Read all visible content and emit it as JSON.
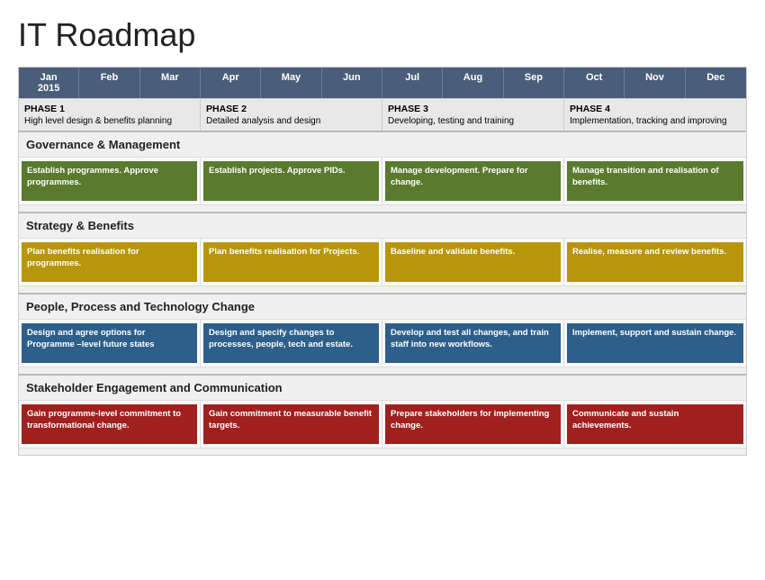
{
  "title": "IT Roadmap",
  "header": {
    "months": [
      "Jan\n2015",
      "Feb",
      "Mar",
      "Apr",
      "May",
      "Jun",
      "Jul",
      "Aug",
      "Sep",
      "Oct",
      "Nov",
      "Dec"
    ]
  },
  "phases": [
    {
      "title": "PHASE 1",
      "subtitle": "High level design & benefits planning",
      "span": 3
    },
    {
      "title": "PHASE 2",
      "subtitle": "Detailed analysis and design",
      "span": 3
    },
    {
      "title": "PHASE 3",
      "subtitle": "Developing, testing and training",
      "span": 3
    },
    {
      "title": "PHASE 4",
      "subtitle": "Implementation, tracking and improving",
      "span": 3
    }
  ],
  "sections": [
    {
      "name": "Governance & Management",
      "tasks": [
        {
          "text": "Establish programmes. Approve programmes.",
          "color": "green",
          "span": 3
        },
        {
          "text": "Establish projects. Approve PIDs.",
          "color": "green",
          "span": 3
        },
        {
          "text": "Manage development. Prepare for change.",
          "color": "green",
          "span": 3
        },
        {
          "text": "Manage transition and realisation of benefits.",
          "color": "green",
          "span": 3
        }
      ]
    },
    {
      "name": "Strategy & Benefits",
      "tasks": [
        {
          "text": "Plan benefits realisation for programmes.",
          "color": "yellow",
          "span": 3
        },
        {
          "text": "Plan benefits realisation for Projects.",
          "color": "yellow",
          "span": 3
        },
        {
          "text": "Baseline and validate benefits.",
          "color": "yellow",
          "span": 3
        },
        {
          "text": "Realise, measure and review benefits.",
          "color": "yellow",
          "span": 3
        }
      ]
    },
    {
      "name": "People, Process and Technology Change",
      "tasks": [
        {
          "text": "Design and agree options for Programme –level future states",
          "color": "blue",
          "span": 3
        },
        {
          "text": "Design and specify changes to processes, people, tech and estate.",
          "color": "blue",
          "span": 3
        },
        {
          "text": "Develop and test all changes, and train staff into new workflows.",
          "color": "blue",
          "span": 3
        },
        {
          "text": "Implement, support and sustain change.",
          "color": "blue",
          "span": 3
        }
      ]
    },
    {
      "name": "Stakeholder Engagement and Communication",
      "tasks": [
        {
          "text": "Gain programme-level commitment to transformational change.",
          "color": "red",
          "span": 3
        },
        {
          "text": "Gain commitment to measurable benefit targets.",
          "color": "red",
          "span": 3
        },
        {
          "text": "Prepare stakeholders for implementing change.",
          "color": "red",
          "span": 3
        },
        {
          "text": "Communicate and sustain achievements.",
          "color": "red",
          "span": 3
        }
      ]
    }
  ]
}
